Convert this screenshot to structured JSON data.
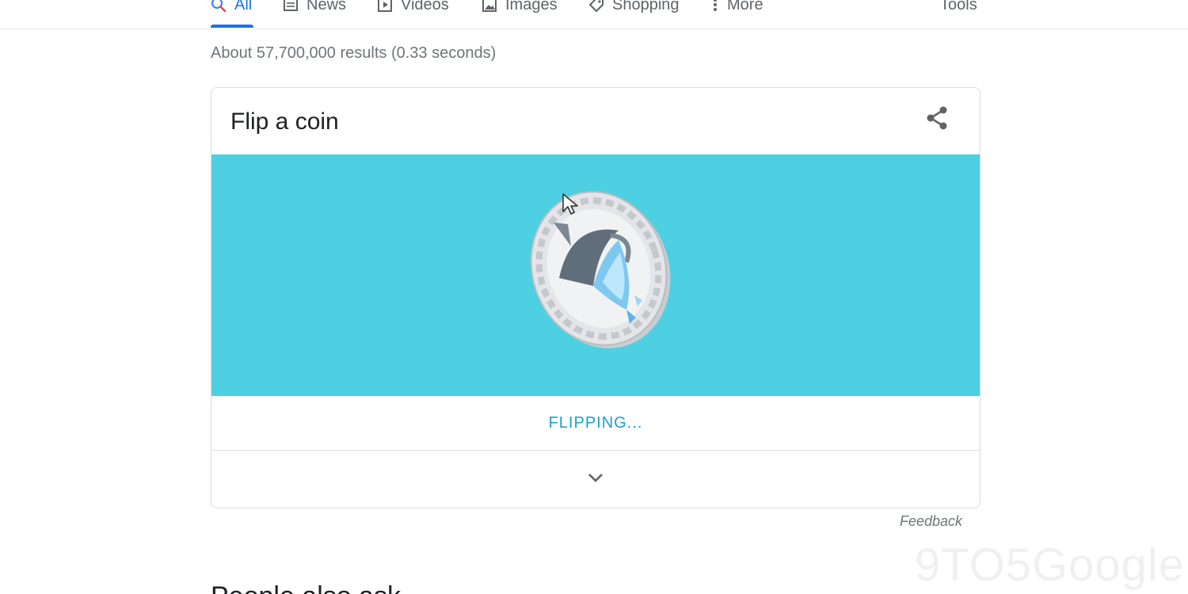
{
  "tabs": [
    {
      "label": "All",
      "icon": "search-icon"
    },
    {
      "label": "News",
      "icon": "news-icon"
    },
    {
      "label": "Videos",
      "icon": "play-icon"
    },
    {
      "label": "Images",
      "icon": "image-icon"
    },
    {
      "label": "Shopping",
      "icon": "tag-icon"
    },
    {
      "label": "More",
      "icon": "more-vert-icon"
    }
  ],
  "tools_label": "Tools",
  "result_stats": "About 57,700,000 results (0.33 seconds)",
  "card": {
    "title": "Flip a coin",
    "status": "FLIPPING...",
    "stage_color": "#4dd0e1"
  },
  "feedback_label": "Feedback",
  "next_heading": "People also ask",
  "watermark": "9TO5Google",
  "colors": {
    "accent": "#1a73e8",
    "status": "#1a9fd0"
  }
}
